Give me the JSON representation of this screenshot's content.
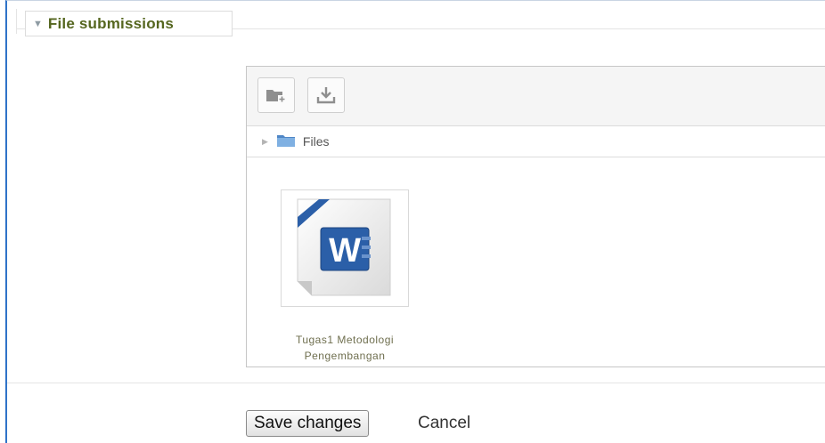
{
  "fieldset": {
    "legend": "File submissions"
  },
  "filepicker": {
    "toolbar": {
      "create_folder_icon": "new-folder-icon",
      "download_icon": "download-icon"
    },
    "path": {
      "folder": "Files"
    },
    "files": [
      {
        "name": "Tugas1 Metodologi Pengembangan",
        "type": "word-document-icon"
      }
    ]
  },
  "actions": {
    "save_label": "Save changes",
    "cancel_label": "Cancel"
  },
  "colors": {
    "legend_text": "#55661f",
    "frame_border": "#2f73c8",
    "word_blue": "#2b5fa8"
  }
}
